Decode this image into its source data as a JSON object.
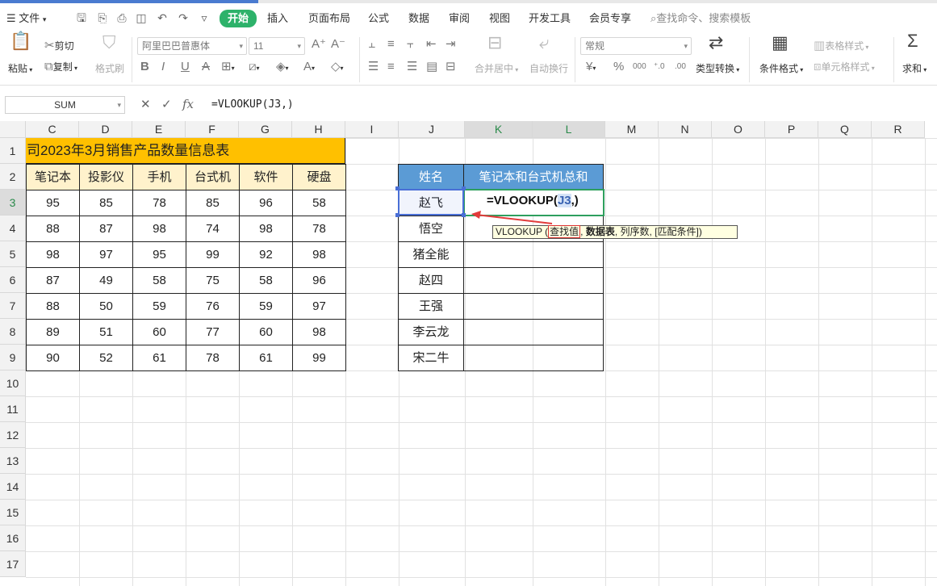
{
  "menu": {
    "file": "文件",
    "tabs": [
      "开始",
      "插入",
      "页面布局",
      "公式",
      "数据",
      "审阅",
      "视图",
      "开发工具",
      "会员专享"
    ],
    "active_tab": "开始",
    "search": "查找命令、搜索模板"
  },
  "ribbon": {
    "paste": "粘贴",
    "cut": "剪切",
    "copy": "复制",
    "format_painter": "格式刷",
    "font_name": "阿里巴巴普惠体",
    "font_size": "11",
    "merge": "合并居中",
    "wrap": "自动换行",
    "number_format": "常规",
    "convert": "类型转换",
    "cond_format": "条件格式",
    "table_style": "表格样式",
    "cell_style": "单元格样式",
    "sum": "求和"
  },
  "formula_bar": {
    "name_box": "SUM",
    "fx": "fx",
    "formula": "=VLOOKUP(J3,)"
  },
  "columns": [
    "C",
    "D",
    "E",
    "F",
    "G",
    "H",
    "I",
    "J",
    "K",
    "L",
    "M",
    "N",
    "O",
    "P",
    "Q",
    "R"
  ],
  "rows": [
    "1",
    "2",
    "3",
    "4",
    "5",
    "6",
    "7",
    "8",
    "9",
    "10",
    "11",
    "12",
    "13",
    "14",
    "15",
    "16",
    "17"
  ],
  "sheet": {
    "title": "司2023年3月销售产品数量信息表",
    "headers": [
      "笔记本",
      "投影仪",
      "手机",
      "台式机",
      "软件",
      "硬盘"
    ],
    "data": [
      [
        "95",
        "85",
        "78",
        "85",
        "96",
        "58"
      ],
      [
        "88",
        "87",
        "98",
        "74",
        "98",
        "78"
      ],
      [
        "98",
        "97",
        "95",
        "99",
        "92",
        "98"
      ],
      [
        "87",
        "49",
        "58",
        "75",
        "58",
        "96"
      ],
      [
        "88",
        "50",
        "59",
        "76",
        "59",
        "97"
      ],
      [
        "89",
        "51",
        "60",
        "77",
        "60",
        "98"
      ],
      [
        "90",
        "52",
        "61",
        "78",
        "61",
        "99"
      ]
    ],
    "lookup_header_name": "姓名",
    "lookup_header_sum": "笔记本和台式机总和",
    "names": [
      "赵飞",
      "悟空",
      "猪全能",
      "赵四",
      "王强",
      "李云龙",
      "宋二牛"
    ]
  },
  "edit": {
    "prefix": "=VLOOKUP(",
    "ref": "J3",
    "suffix": ",)"
  },
  "tooltip": {
    "fn": "VLOOKUP",
    "arg1": "查找值",
    "arg2": "数据表",
    "rest": "列序数, [匹配条件])"
  },
  "colors": {
    "title_bg": "#ffc000",
    "header_bg": "#fff2cc",
    "lookup_header_bg": "#5b9bd5",
    "active_tab": "#2db26a",
    "edit_border": "#2e9f5e"
  }
}
